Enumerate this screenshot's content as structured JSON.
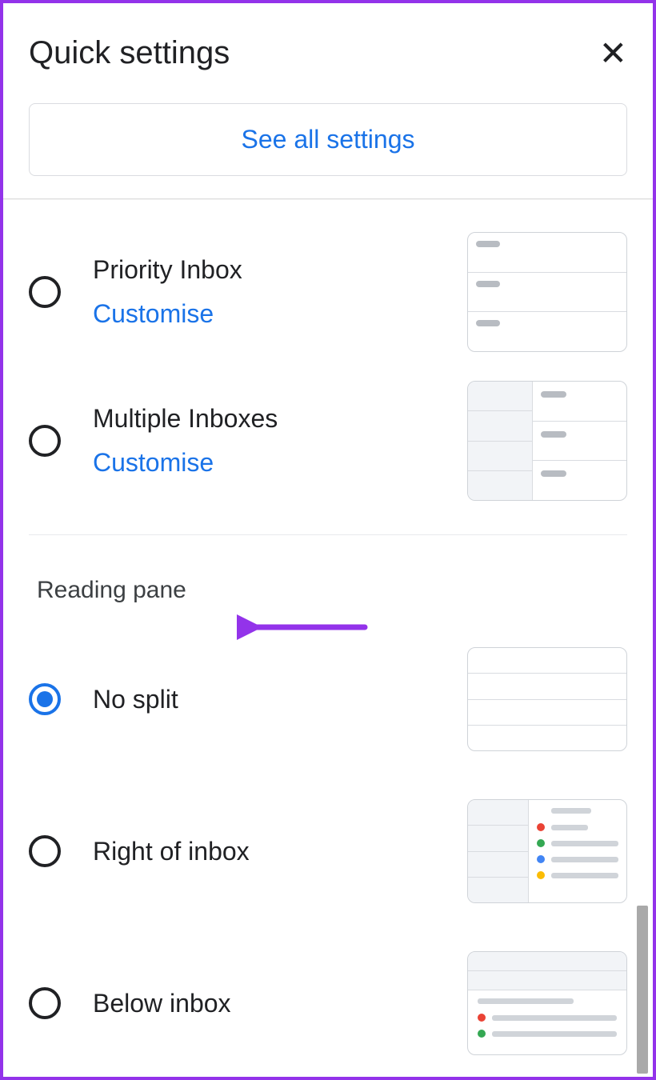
{
  "header": {
    "title": "Quick settings"
  },
  "see_all_button": "See all settings",
  "inbox_options": [
    {
      "label": "Priority Inbox",
      "customise": "Customise"
    },
    {
      "label": "Multiple Inboxes",
      "customise": "Customise"
    }
  ],
  "reading_pane": {
    "section_title": "Reading pane",
    "options": [
      {
        "label": "No split",
        "selected": true
      },
      {
        "label": "Right of inbox",
        "selected": false
      },
      {
        "label": "Below inbox",
        "selected": false
      }
    ]
  }
}
